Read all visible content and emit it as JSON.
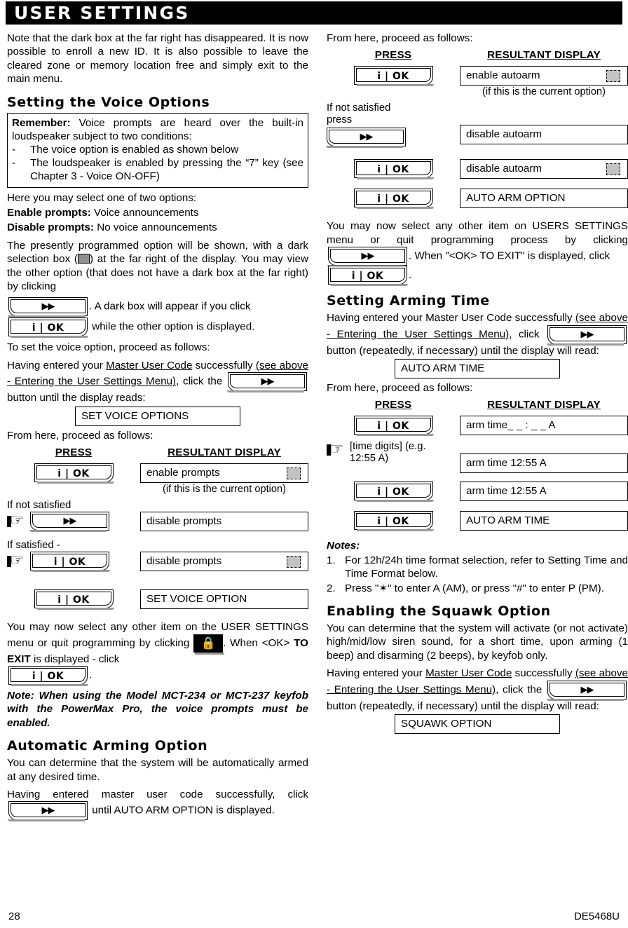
{
  "banner": {
    "title": "USER SETTINGS"
  },
  "left": {
    "intro": "Note that the dark box at the far right has disappeared. It is now possible to enroll a new ID. It is also possible to leave the cleared zone or memory location free and simply exit to the main menu.",
    "heading_voice": "Setting the Voice Options",
    "remember": {
      "label": "Remember:",
      "lead": " Voice prompts are heard over the built-in loudspeaker subject to two conditions:",
      "dash": "-",
      "b1": "The voice option is enabled as shown below",
      "b2": "The loudspeaker is enabled by pressing the “7” key (see Chapter 3 - Voice ON-OFF)"
    },
    "select_one": "Here you may select one of two options:",
    "enable_label": "Enable prompts:",
    "enable_text": " Voice announcements",
    "disable_label": "Disable prompts:",
    "disable_text": " No voice announcements",
    "presently_1": "The presently programmed option will be shown, with a dark selection box (",
    "presently_2": ") at the far right of the display. You may view the other option (that does not have a dark box at the far right) by clicking",
    "presently_3": ". A dark box will appear if you click",
    "presently_4": "while the other option is displayed.",
    "to_set": "To set the voice option, proceed as follows:",
    "having_1": "Having entered your ",
    "having_code": "Master User Code",
    "having_2": " successfully ",
    "having_3": "(see above - Entering the User Settings Menu)",
    "having_4": ", click the",
    "having_5": "button until the display reads:",
    "lcd_set_voice_options": "SET VOICE OPTIONS",
    "from_here": "From here, proceed as follows:",
    "table": {
      "header_press": "PRESS",
      "header_result": "RESULTANT DISPLAY",
      "rows": [
        {
          "press_button": "ok",
          "press_label": "",
          "result": "enable prompts",
          "selected": true,
          "caption": "(if this is the current option)"
        },
        {
          "press_button": "arrow",
          "press_label": "If not satisfied",
          "hand": true,
          "result": "disable prompts",
          "selected": false,
          "caption": ""
        },
        {
          "press_button": "ok",
          "press_label": "If satisfied -",
          "hand": true,
          "result": "disable prompts",
          "selected": true,
          "caption": ""
        },
        {
          "press_button": "ok",
          "press_label": "",
          "result": "SET VOICE OPTION",
          "selected": false,
          "caption": ""
        }
      ]
    },
    "after_1": "You may now select any other item on the USER SETTINGS menu or quit programming by clicking",
    "after_lock_glyph": "🔒",
    "after_2": ". When ",
    "after_ok_angle": "<OK>",
    "after_toexit": "TO EXIT",
    "after_3": " is displayed - click",
    "after_4": ".",
    "note_mct": "Note: When using the Model MCT-234 or MCT-237 keyfob with the PowerMax Pro, the voice prompts must be enabled.",
    "heading_autoarm": "Automatic Arming Option",
    "autoarm_p1": "You can determine that the system will be automatically armed at any desired time.",
    "autoarm_p2a": "Having entered master user code successfully, click",
    "autoarm_p2b": "until AUTO ARM OPTION is displayed."
  },
  "right": {
    "from_here": "From here, proceed as follows:",
    "table1": {
      "header_press": "PRESS",
      "header_result": "RESULTANT DISPLAY",
      "rows": [
        {
          "press_button": "ok",
          "press_label": "",
          "result": "enable autoarm",
          "selected": true,
          "caption": "(if this is the current option)"
        },
        {
          "press_button": "arrow",
          "press_label": "If not satisfied press",
          "result": "disable autoarm",
          "selected": false,
          "caption": ""
        },
        {
          "press_button": "ok",
          "press_label": "",
          "result": "disable autoarm",
          "selected": true,
          "caption": ""
        },
        {
          "press_button": "ok",
          "press_label": "",
          "result": "AUTO ARM OPTION",
          "selected": false,
          "caption": ""
        }
      ]
    },
    "after_1": "You may now select any other item on USERS SETTINGS menu or quit programming process by clicking",
    "after_2": ". When \"<OK> TO EXIT\" is displayed, click",
    "after_3": ".",
    "heading_arming_time": "Setting Arming Time",
    "arm_p1a": "Having entered your Master User Code successfully ",
    "arm_p1b": "(see above - Entering the User Settings Menu)",
    "arm_p1c": ", click",
    "arm_p1d": "button (repeatedly, if necessary) until the display will read:",
    "lcd_auto_arm_time": "AUTO ARM TIME",
    "from_here2": "From here, proceed as follows:",
    "table2": {
      "header_press": "PRESS",
      "header_result": "RESULTANT DISPLAY",
      "rows": [
        {
          "press_button": "ok",
          "press_label": "",
          "result": "arm time_ _ : _ _ A",
          "selected": false,
          "caption": ""
        },
        {
          "press_button": "hand-text",
          "press_label": "[time digits] (e.g. 12:55 A)",
          "result": "arm time 12:55 A",
          "selected": false,
          "caption": ""
        },
        {
          "press_button": "ok",
          "press_label": "",
          "result": "arm time 12:55 A",
          "selected": false,
          "caption": ""
        },
        {
          "press_button": "ok",
          "press_label": "",
          "result": "AUTO ARM TIME",
          "selected": false,
          "caption": ""
        }
      ]
    },
    "notes_label": "Notes:",
    "note1_num": "1.",
    "note1": "For 12h/24h time format selection, refer to Setting Time and Time Format  below.",
    "note2_num": "2.",
    "note2": "Press \"✶\" to enter A (AM), or press \"#\" to enter P (PM).",
    "heading_squawk": "Enabling the Squawk Option",
    "squawk_p1": "You can determine that the system will activate (or not activate) high/mid/low siren sound, for a short time, upon arming (1 beep) and disarming (2 beeps), by keyfob only.",
    "squawk_p2a": "Having entered your ",
    "squawk_code": "Master User Code",
    "squawk_p2b": " successfully ",
    "squawk_p2c": "(see above - Entering the User Settings Menu)",
    "squawk_p2d": ", click the",
    "squawk_p2e": "button (repeatedly, if necessary) until the display will read:",
    "lcd_squawk": "SQUAWK OPTION"
  },
  "icons": {
    "ok_label": "i | OK",
    "arrow_label": "▶▶",
    "hand": "☞",
    "lock": "🔒"
  },
  "footer": {
    "page": "28",
    "doc": "DE5468U"
  }
}
